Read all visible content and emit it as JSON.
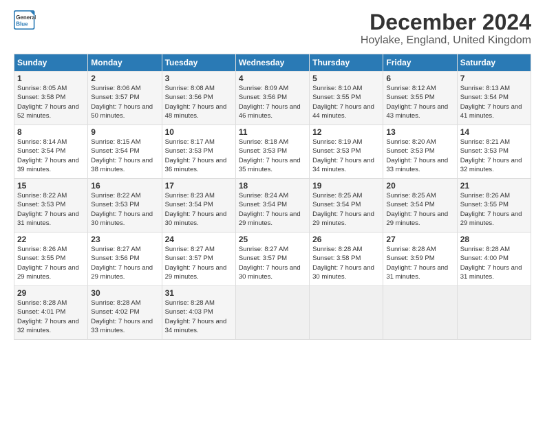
{
  "logo": {
    "line1": "General",
    "line2": "Blue"
  },
  "title": "December 2024",
  "subtitle": "Hoylake, England, United Kingdom",
  "days_header": [
    "Sunday",
    "Monday",
    "Tuesday",
    "Wednesday",
    "Thursday",
    "Friday",
    "Saturday"
  ],
  "weeks": [
    [
      {
        "day": "1",
        "sunrise": "8:05 AM",
        "sunset": "3:58 PM",
        "daylight": "7 hours and 52 minutes."
      },
      {
        "day": "2",
        "sunrise": "8:06 AM",
        "sunset": "3:57 PM",
        "daylight": "7 hours and 50 minutes."
      },
      {
        "day": "3",
        "sunrise": "8:08 AM",
        "sunset": "3:56 PM",
        "daylight": "7 hours and 48 minutes."
      },
      {
        "day": "4",
        "sunrise": "8:09 AM",
        "sunset": "3:56 PM",
        "daylight": "7 hours and 46 minutes."
      },
      {
        "day": "5",
        "sunrise": "8:10 AM",
        "sunset": "3:55 PM",
        "daylight": "7 hours and 44 minutes."
      },
      {
        "day": "6",
        "sunrise": "8:12 AM",
        "sunset": "3:55 PM",
        "daylight": "7 hours and 43 minutes."
      },
      {
        "day": "7",
        "sunrise": "8:13 AM",
        "sunset": "3:54 PM",
        "daylight": "7 hours and 41 minutes."
      }
    ],
    [
      {
        "day": "8",
        "sunrise": "8:14 AM",
        "sunset": "3:54 PM",
        "daylight": "7 hours and 39 minutes."
      },
      {
        "day": "9",
        "sunrise": "8:15 AM",
        "sunset": "3:54 PM",
        "daylight": "7 hours and 38 minutes."
      },
      {
        "day": "10",
        "sunrise": "8:17 AM",
        "sunset": "3:53 PM",
        "daylight": "7 hours and 36 minutes."
      },
      {
        "day": "11",
        "sunrise": "8:18 AM",
        "sunset": "3:53 PM",
        "daylight": "7 hours and 35 minutes."
      },
      {
        "day": "12",
        "sunrise": "8:19 AM",
        "sunset": "3:53 PM",
        "daylight": "7 hours and 34 minutes."
      },
      {
        "day": "13",
        "sunrise": "8:20 AM",
        "sunset": "3:53 PM",
        "daylight": "7 hours and 33 minutes."
      },
      {
        "day": "14",
        "sunrise": "8:21 AM",
        "sunset": "3:53 PM",
        "daylight": "7 hours and 32 minutes."
      }
    ],
    [
      {
        "day": "15",
        "sunrise": "8:22 AM",
        "sunset": "3:53 PM",
        "daylight": "7 hours and 31 minutes."
      },
      {
        "day": "16",
        "sunrise": "8:22 AM",
        "sunset": "3:53 PM",
        "daylight": "7 hours and 30 minutes."
      },
      {
        "day": "17",
        "sunrise": "8:23 AM",
        "sunset": "3:54 PM",
        "daylight": "7 hours and 30 minutes."
      },
      {
        "day": "18",
        "sunrise": "8:24 AM",
        "sunset": "3:54 PM",
        "daylight": "7 hours and 29 minutes."
      },
      {
        "day": "19",
        "sunrise": "8:25 AM",
        "sunset": "3:54 PM",
        "daylight": "7 hours and 29 minutes."
      },
      {
        "day": "20",
        "sunrise": "8:25 AM",
        "sunset": "3:54 PM",
        "daylight": "7 hours and 29 minutes."
      },
      {
        "day": "21",
        "sunrise": "8:26 AM",
        "sunset": "3:55 PM",
        "daylight": "7 hours and 29 minutes."
      }
    ],
    [
      {
        "day": "22",
        "sunrise": "8:26 AM",
        "sunset": "3:55 PM",
        "daylight": "7 hours and 29 minutes."
      },
      {
        "day": "23",
        "sunrise": "8:27 AM",
        "sunset": "3:56 PM",
        "daylight": "7 hours and 29 minutes."
      },
      {
        "day": "24",
        "sunrise": "8:27 AM",
        "sunset": "3:57 PM",
        "daylight": "7 hours and 29 minutes."
      },
      {
        "day": "25",
        "sunrise": "8:27 AM",
        "sunset": "3:57 PM",
        "daylight": "7 hours and 30 minutes."
      },
      {
        "day": "26",
        "sunrise": "8:28 AM",
        "sunset": "3:58 PM",
        "daylight": "7 hours and 30 minutes."
      },
      {
        "day": "27",
        "sunrise": "8:28 AM",
        "sunset": "3:59 PM",
        "daylight": "7 hours and 31 minutes."
      },
      {
        "day": "28",
        "sunrise": "8:28 AM",
        "sunset": "4:00 PM",
        "daylight": "7 hours and 31 minutes."
      }
    ],
    [
      {
        "day": "29",
        "sunrise": "8:28 AM",
        "sunset": "4:01 PM",
        "daylight": "7 hours and 32 minutes."
      },
      {
        "day": "30",
        "sunrise": "8:28 AM",
        "sunset": "4:02 PM",
        "daylight": "7 hours and 33 minutes."
      },
      {
        "day": "31",
        "sunrise": "8:28 AM",
        "sunset": "4:03 PM",
        "daylight": "7 hours and 34 minutes."
      },
      null,
      null,
      null,
      null
    ]
  ],
  "labels": {
    "sunrise": "Sunrise: ",
    "sunset": "Sunset: ",
    "daylight": "Daylight: "
  }
}
